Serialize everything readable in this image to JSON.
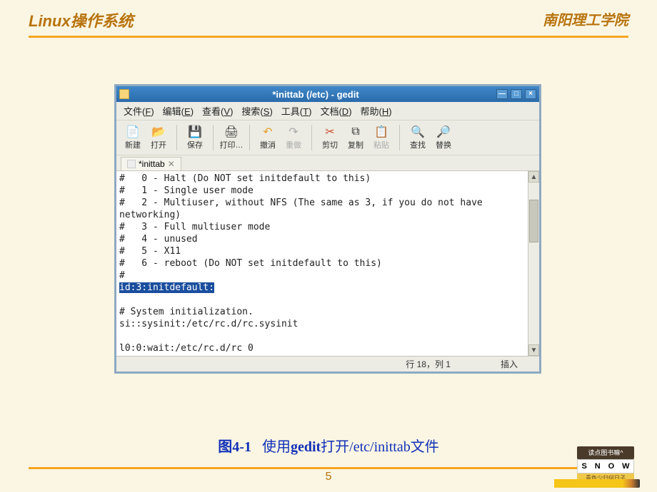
{
  "header": {
    "left": "Linux操作系统",
    "right": "南阳理工学院"
  },
  "window": {
    "title": "*inittab (/etc) - gedit",
    "controls": {
      "min": "—",
      "max": "□",
      "close": "×"
    }
  },
  "menubar": {
    "items": [
      {
        "label": "文件",
        "accel": "F"
      },
      {
        "label": "编辑",
        "accel": "E"
      },
      {
        "label": "查看",
        "accel": "V"
      },
      {
        "label": "搜索",
        "accel": "S"
      },
      {
        "label": "工具",
        "accel": "T"
      },
      {
        "label": "文档",
        "accel": "D"
      },
      {
        "label": "帮助",
        "accel": "H"
      }
    ]
  },
  "toolbar": {
    "new": "新建",
    "open": "打开",
    "save": "保存",
    "print": "打印…",
    "undo": "撤消",
    "redo": "重做",
    "cut": "剪切",
    "copy": "复制",
    "paste": "粘贴",
    "find": "查找",
    "replace": "替换"
  },
  "tab": {
    "label": "*inittab"
  },
  "editor": {
    "lines": [
      "#   0 - Halt (Do NOT set initdefault to this)",
      "#   1 - Single user mode",
      "#   2 - Multiuser, without NFS (The same as 3, if you do not have",
      "networking)",
      "#   3 - Full multiuser mode",
      "#   4 - unused",
      "#   5 - X11",
      "#   6 - reboot (Do NOT set initdefault to this)",
      "#"
    ],
    "highlighted": "id:3:initdefault:",
    "after": [
      "",
      "# System initialization.",
      "si::sysinit:/etc/rc.d/rc.sysinit",
      "",
      "l0:0:wait:/etc/rc.d/rc 0"
    ]
  },
  "statusbar": {
    "cursor": "行 18，列 1",
    "mode": "插入"
  },
  "caption": {
    "fig_prefix": "图4-1",
    "text_before": "使用",
    "gedit": "gedit",
    "text_mid": "打开/etc/inittab",
    "text_end": "文件"
  },
  "page_num": "5",
  "deco": {
    "sign": "读点图书嘛^",
    "snow_letters": [
      "S",
      "N",
      "O",
      "W"
    ],
    "base": "青色少归何日子"
  }
}
